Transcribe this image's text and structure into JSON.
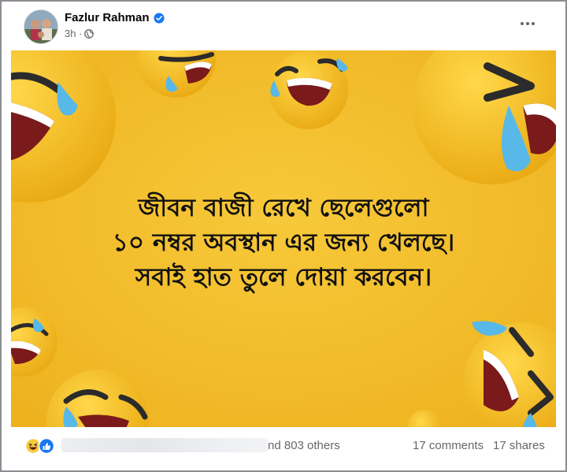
{
  "post": {
    "author": "Fazlur Rahman",
    "time": "3h ·",
    "image_text": [
      "জীবন বাজী রেখে ছেলেগুলো",
      "১০ নম্বর অবস্থান এর জন্য খেলছে।",
      "সবাই হাত তুলে দোয়া করবেন।"
    ]
  },
  "footer": {
    "reactions_suffix": "nd 803 others",
    "comments": "17 comments",
    "shares": "17 shares"
  },
  "icons": {
    "verified": "verified-badge-icon",
    "privacy": "globe-icon",
    "more": "more-options-icon",
    "reactions": [
      "haha-reaction-icon",
      "like-reaction-icon"
    ]
  },
  "colors": {
    "background_yellow": "#f2be2a",
    "emoji_yellow": "#f5c21f",
    "tear_blue": "#58b8e8",
    "facebook_blue": "#1877f2"
  }
}
